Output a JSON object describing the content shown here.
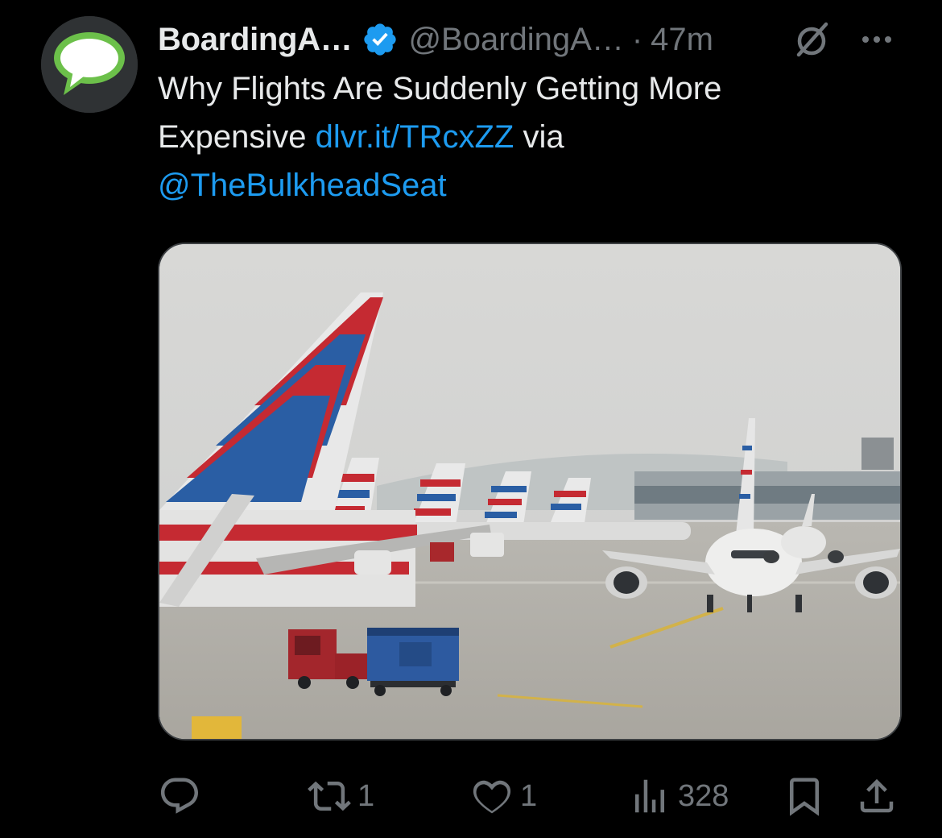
{
  "tweet": {
    "display_name": "BoardingA…",
    "handle": "@BoardingA…",
    "separator": "·",
    "time": "47m",
    "body": {
      "text_1": "Why Flights Are Suddenly Getting More Expensive ",
      "link_1": "dlvr.it/TRcxZZ",
      "text_2": " via ",
      "mention": "@TheBulkheadSeat"
    },
    "icons": {
      "verified": "verified-badge-icon",
      "grok": "grok-icon",
      "more": "more-icon",
      "reply": "reply-icon",
      "repost": "repost-icon",
      "like": "like-icon",
      "views": "views-icon",
      "bookmark": "bookmark-icon",
      "share": "share-icon"
    },
    "stats": {
      "reposts": "1",
      "likes": "1",
      "views": "328"
    },
    "colors": {
      "background": "#000000",
      "text": "#e7e9ea",
      "muted": "#71767b",
      "link": "#1d9bf0",
      "avatar_bubble": "#6cc04a"
    }
  }
}
